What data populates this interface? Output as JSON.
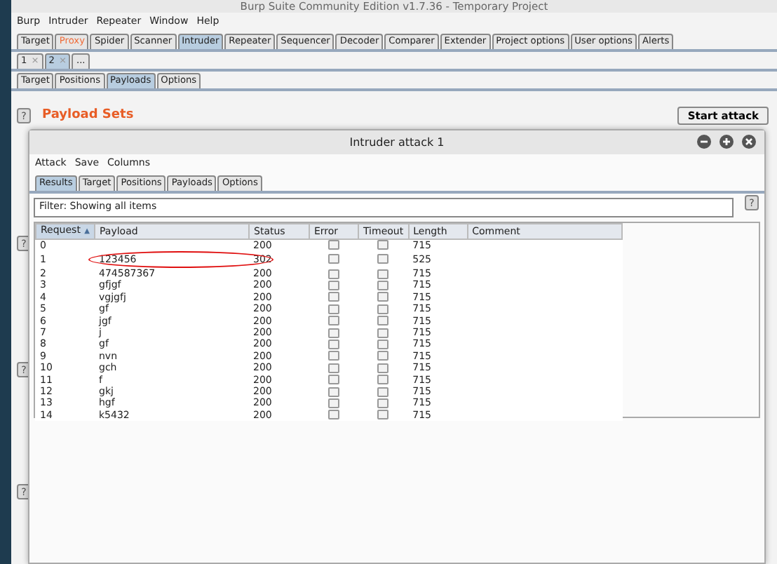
{
  "window": {
    "title": "Burp Suite Community Edition v1.7.36 - Temporary Project"
  },
  "menu": [
    "Burp",
    "Intruder",
    "Repeater",
    "Window",
    "Help"
  ],
  "tool_tabs": [
    {
      "label": "Target",
      "selected": false,
      "alert": false
    },
    {
      "label": "Proxy",
      "selected": false,
      "alert": true
    },
    {
      "label": "Spider",
      "selected": false,
      "alert": false
    },
    {
      "label": "Scanner",
      "selected": false,
      "alert": false
    },
    {
      "label": "Intruder",
      "selected": true,
      "alert": false
    },
    {
      "label": "Repeater",
      "selected": false,
      "alert": false
    },
    {
      "label": "Sequencer",
      "selected": false,
      "alert": false
    },
    {
      "label": "Decoder",
      "selected": false,
      "alert": false
    },
    {
      "label": "Comparer",
      "selected": false,
      "alert": false
    },
    {
      "label": "Extender",
      "selected": false,
      "alert": false
    },
    {
      "label": "Project options",
      "selected": false,
      "alert": false
    },
    {
      "label": "User options",
      "selected": false,
      "alert": false
    },
    {
      "label": "Alerts",
      "selected": false,
      "alert": false
    }
  ],
  "attack_tabs": [
    {
      "label": "1",
      "close": "×",
      "selected": false
    },
    {
      "label": "2",
      "close": "×",
      "selected": true
    },
    {
      "label": "...",
      "selected": false
    }
  ],
  "intruder_tabs": [
    {
      "label": "Target",
      "selected": false
    },
    {
      "label": "Positions",
      "selected": false
    },
    {
      "label": "Payloads",
      "selected": true
    },
    {
      "label": "Options",
      "selected": false
    }
  ],
  "section": {
    "help": "?",
    "heading": "Payload Sets",
    "button": "Start attack",
    "help_lower": [
      "?",
      "?",
      "?"
    ]
  },
  "attack_window": {
    "title": "Intruder attack 1",
    "menu": [
      "Attack",
      "Save",
      "Columns"
    ],
    "tabs": [
      {
        "label": "Results",
        "selected": true
      },
      {
        "label": "Target",
        "selected": false
      },
      {
        "label": "Positions",
        "selected": false
      },
      {
        "label": "Payloads",
        "selected": false
      },
      {
        "label": "Options",
        "selected": false
      }
    ],
    "filter": "Filter: Showing all items",
    "filter_help": "?",
    "table": {
      "columns": [
        {
          "label": "Request",
          "sorted": true,
          "sort_arrow": "▲"
        },
        {
          "label": "Payload",
          "sorted": false
        },
        {
          "label": "Status",
          "sorted": false
        },
        {
          "label": "Error",
          "sorted": false
        },
        {
          "label": "Timeout",
          "sorted": false
        },
        {
          "label": "Length",
          "sorted": false
        },
        {
          "label": "Comment",
          "sorted": false
        }
      ],
      "rows": [
        {
          "request": "0",
          "payload": "",
          "status": "200",
          "error": false,
          "timeout": false,
          "length": "715",
          "circled": false
        },
        {
          "request": "1",
          "payload": "123456",
          "status": "302",
          "error": false,
          "timeout": false,
          "length": "525",
          "circled": true
        },
        {
          "request": "2",
          "payload": "474587367",
          "status": "200",
          "error": false,
          "timeout": false,
          "length": "715",
          "circled": false
        },
        {
          "request": "3",
          "payload": "gfjgf",
          "status": "200",
          "error": false,
          "timeout": false,
          "length": "715",
          "circled": false
        },
        {
          "request": "4",
          "payload": "vgjgfj",
          "status": "200",
          "error": false,
          "timeout": false,
          "length": "715",
          "circled": false
        },
        {
          "request": "5",
          "payload": "gf",
          "status": "200",
          "error": false,
          "timeout": false,
          "length": "715",
          "circled": false
        },
        {
          "request": "6",
          "payload": "jgf",
          "status": "200",
          "error": false,
          "timeout": false,
          "length": "715",
          "circled": false
        },
        {
          "request": "7",
          "payload": "j",
          "status": "200",
          "error": false,
          "timeout": false,
          "length": "715",
          "circled": false
        },
        {
          "request": "8",
          "payload": "gf",
          "status": "200",
          "error": false,
          "timeout": false,
          "length": "715",
          "circled": false
        },
        {
          "request": "9",
          "payload": "nvn",
          "status": "200",
          "error": false,
          "timeout": false,
          "length": "715",
          "circled": false
        },
        {
          "request": "10",
          "payload": "gch",
          "status": "200",
          "error": false,
          "timeout": false,
          "length": "715",
          "circled": false
        },
        {
          "request": "11",
          "payload": "f",
          "status": "200",
          "error": false,
          "timeout": false,
          "length": "715",
          "circled": false
        },
        {
          "request": "12",
          "payload": "gkj",
          "status": "200",
          "error": false,
          "timeout": false,
          "length": "715",
          "circled": false
        },
        {
          "request": "13",
          "payload": "hgf",
          "status": "200",
          "error": false,
          "timeout": false,
          "length": "715",
          "circled": false
        },
        {
          "request": "14",
          "payload": "k5432",
          "status": "200",
          "error": false,
          "timeout": false,
          "length": "715",
          "circled": false
        }
      ]
    }
  }
}
